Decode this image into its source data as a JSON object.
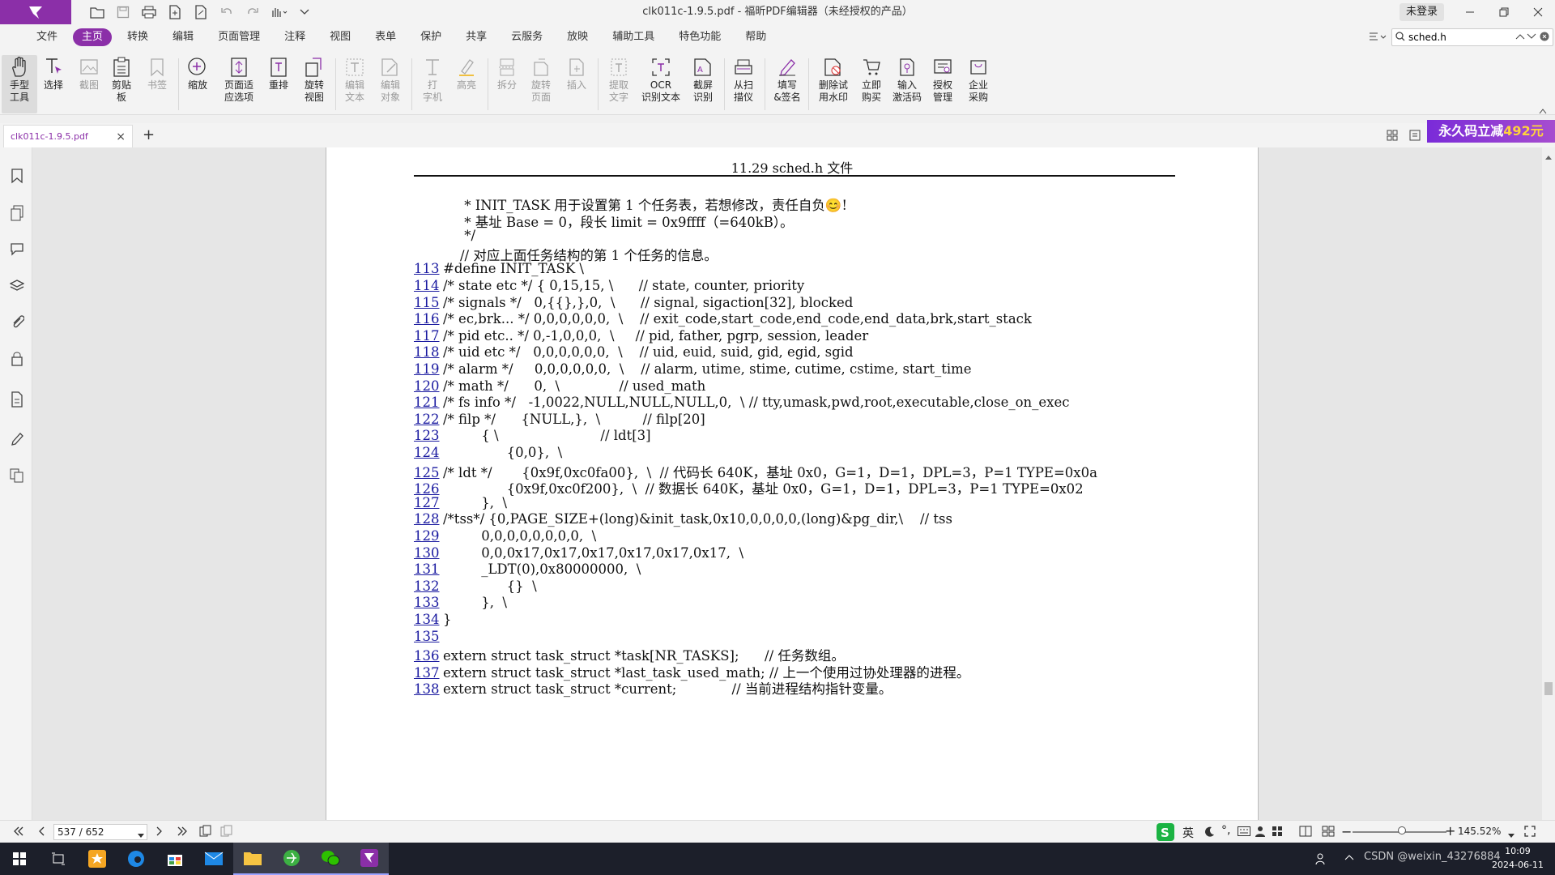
{
  "window": {
    "title": "clk011c-1.9.5.pdf - 福昕PDF编辑器（未经授权的产品）",
    "login": "未登录"
  },
  "menu": {
    "tabs": [
      "文件",
      "主页",
      "转换",
      "编辑",
      "页面管理",
      "注释",
      "视图",
      "表单",
      "保护",
      "共享",
      "云服务",
      "放映",
      "辅助工具",
      "特色功能",
      "帮助"
    ],
    "active": "主页"
  },
  "search": {
    "value": "sched.h"
  },
  "ribbon": {
    "hand": "手型\n工具",
    "select": "选择",
    "screenshot": "截图",
    "clipboard": "剪贴\n板",
    "bookmark": "书签",
    "zoom": "缩放",
    "fit_page": "页面适\n应选项",
    "reflow": "重排",
    "rotate_view": "旋转\n视图",
    "edit_text": "编辑\n文本",
    "edit_object": "编辑\n对象",
    "typewriter": "打\n字机",
    "highlight": "高亮",
    "split": "拆分",
    "rotate_page": "旋转\n页面",
    "insert": "插入",
    "extract_text": "提取\n文字",
    "ocr": "OCR\n识别文本",
    "capture_ocr": "截屏\n识别",
    "scan": "从扫\n描仪",
    "fill_sign": "填写\n&签名",
    "remove_watermark": "删除试\n用水印",
    "buy": "立即\n购买",
    "activate": "输入\n激活码",
    "license": "授权\n管理",
    "enterprise": "企业\n采购"
  },
  "doc_tab": {
    "name": "clk011c-1.9.5.pdf"
  },
  "promo": {
    "text": "永久码立减",
    "amount": "492元"
  },
  "page": {
    "header": "11.29  sched.h 文件",
    "lines": [
      {
        "n": "",
        "t": "     * INIT_TASK 用于设置第 1 个任务表，若想修改，责任自负😊!"
      },
      {
        "n": "",
        "t": "     * 基址 Base = 0，段长 limit = 0x9ffff（=640kB）。"
      },
      {
        "n": "",
        "t": "     */"
      },
      {
        "n": "",
        "t": "    // 对应上面任务结构的第 1 个任务的信息。"
      },
      {
        "n": "113",
        "t": "#define INIT_TASK \\"
      },
      {
        "n": "114",
        "t": "/* state etc */ { 0,15,15, \\      // state, counter, priority"
      },
      {
        "n": "115",
        "t": "/* signals */   0,{{},},0,  \\      // signal, sigaction[32], blocked"
      },
      {
        "n": "116",
        "t": "/* ec,brk... */ 0,0,0,0,0,0,  \\    // exit_code,start_code,end_code,end_data,brk,start_stack"
      },
      {
        "n": "117",
        "t": "/* pid etc.. */ 0,-1,0,0,0,  \\     // pid, father, pgrp, session, leader"
      },
      {
        "n": "118",
        "t": "/* uid etc */   0,0,0,0,0,0,  \\    // uid, euid, suid, gid, egid, sgid"
      },
      {
        "n": "119",
        "t": "/* alarm */     0,0,0,0,0,0,  \\    // alarm, utime, stime, cutime, cstime, start_time"
      },
      {
        "n": "120",
        "t": "/* math */      0,  \\              // used_math"
      },
      {
        "n": "121",
        "t": "/* fs info */   -1,0022,NULL,NULL,NULL,0,  \\ // tty,umask,pwd,root,executable,close_on_exec"
      },
      {
        "n": "122",
        "t": "/* filp */      {NULL,},  \\          // filp[20]"
      },
      {
        "n": "123",
        "t": "         { \\                        // ldt[3]"
      },
      {
        "n": "124",
        "t": "               {0,0},  \\"
      },
      {
        "n": "125",
        "t": "/* ldt */       {0x9f,0xc0fa00},  \\  // 代码长 640K，基址 0x0，G=1，D=1，DPL=3，P=1 TYPE=0x0a"
      },
      {
        "n": "126",
        "t": "               {0x9f,0xc0f200},  \\  // 数据长 640K，基址 0x0，G=1，D=1，DPL=3，P=1 TYPE=0x02"
      },
      {
        "n": "127",
        "t": "         },  \\"
      },
      {
        "n": "128",
        "t": "/*tss*/ {0,PAGE_SIZE+(long)&init_task,0x10,0,0,0,0,(long)&pg_dir,\\    // tss"
      },
      {
        "n": "129",
        "t": "         0,0,0,0,0,0,0,0,  \\"
      },
      {
        "n": "130",
        "t": "         0,0,0x17,0x17,0x17,0x17,0x17,0x17,  \\"
      },
      {
        "n": "131",
        "t": "         _LDT(0),0x80000000,  \\"
      },
      {
        "n": "132",
        "t": "               {}  \\"
      },
      {
        "n": "133",
        "t": "         },  \\"
      },
      {
        "n": "134",
        "t": "}"
      },
      {
        "n": "135",
        "t": ""
      },
      {
        "n": "136",
        "t": "extern struct task_struct *task[NR_TASKS];      // 任务数组。"
      },
      {
        "n": "137",
        "t": "extern struct task_struct *last_task_used_math; // 上一个使用过协处理器的进程。"
      },
      {
        "n": "138",
        "t": "extern struct task_struct *current;             // 当前进程结构指针变量。"
      }
    ]
  },
  "status": {
    "page_display": "537 / 652",
    "zoom": "145.52%"
  },
  "taskbar": {
    "time": "10:09",
    "date": "2024-06-11",
    "lang": "英",
    "watermark": "CSDN @weixin_43276884"
  }
}
